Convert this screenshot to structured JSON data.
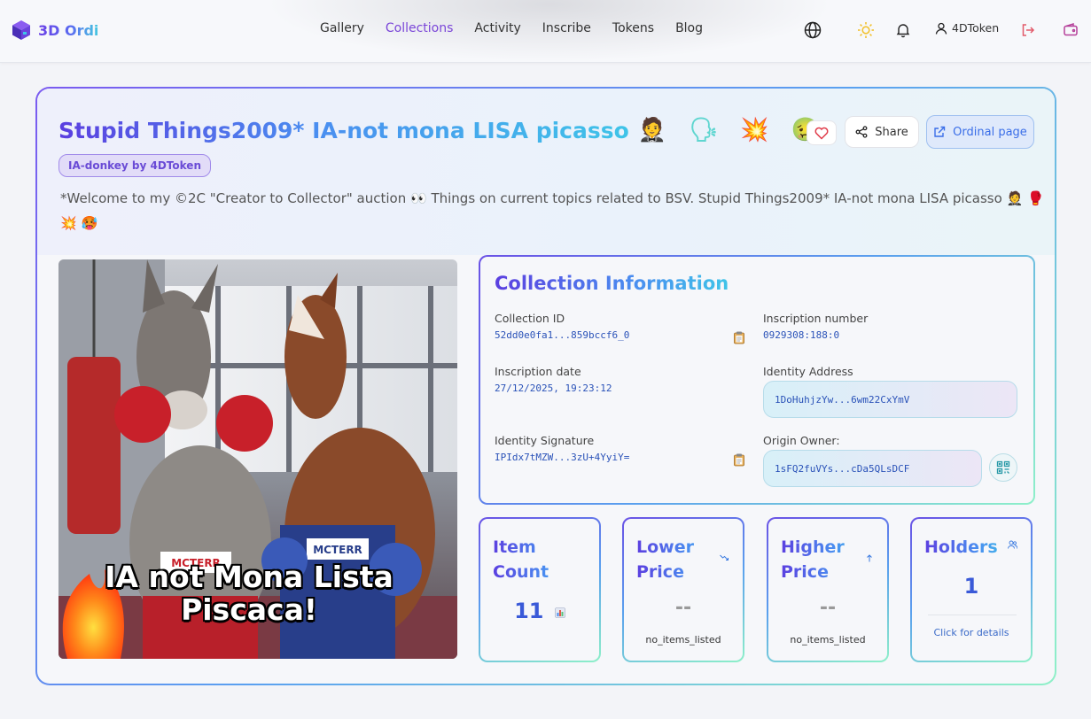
{
  "header": {
    "logo_text": "3D Ordi",
    "nav": [
      {
        "label": "Gallery"
      },
      {
        "label": "Collections"
      },
      {
        "label": "Activity"
      },
      {
        "label": "Inscribe"
      },
      {
        "label": "Tokens"
      },
      {
        "label": "Blog"
      }
    ],
    "active_nav": "Collections",
    "user_name": "4DToken",
    "icons": [
      "globe-icon",
      "sun-icon",
      "bell-icon",
      "user-icon",
      "logout-icon",
      "wallet-icon"
    ]
  },
  "collection": {
    "title": "Stupid Things2009* IA-not mona LISA picasso",
    "title_emoji": "🤵 🗣 💥 🤢",
    "badge": "IA-donkey by 4DToken",
    "description": "*Welcome to my ©2C \"Creator to Collector\" auction 👀 Things on current topics related to BSV. Stupid Things2009* IA-not mona LISA picasso 🤵 🥊 💥 🥵",
    "share_label": "Share",
    "ordinal_label": "Ordinal page"
  },
  "artwork": {
    "caption_line1": "IA not Mona Lista",
    "caption_line2": "Piscaca!",
    "trunk_label_left": "MCTERR",
    "trunk_label_right": "MCTERR"
  },
  "info": {
    "title": "Collection Information",
    "collection_id_label": "Collection ID",
    "collection_id": "52dd0e0fa1...859bccf6_0",
    "inscription_number_label": "Inscription number",
    "inscription_number": "0929308:188:0",
    "inscription_date_label": "Inscription date",
    "inscription_date": "27/12/2025, 19:23:12",
    "identity_address_label": "Identity Address",
    "identity_address": "1DoHuhjzYw...6wm22CxYmV",
    "identity_signature_label": "Identity Signature",
    "identity_signature": "IPIdx7tMZW...3zU+4YyiY=",
    "origin_owner_label": "Origin Owner:",
    "origin_owner": "1sFQ2fuVYs...cDa5QLsDCF"
  },
  "stats": {
    "item_count": {
      "title": "Item Count",
      "value": "11"
    },
    "lower_price": {
      "title": "Lower Price",
      "value": "--",
      "sub": "no_items_listed"
    },
    "higher_price": {
      "title": "Higher Price",
      "value": "--",
      "sub": "no_items_listed"
    },
    "holders": {
      "title": "Holders",
      "value": "1",
      "sub": "Click for details"
    }
  },
  "colors": {
    "accent": "#7a45d8",
    "link_blue": "#2a52b8",
    "gradient_start": "#5b3fe0",
    "gradient_end": "#3fc4e8"
  }
}
